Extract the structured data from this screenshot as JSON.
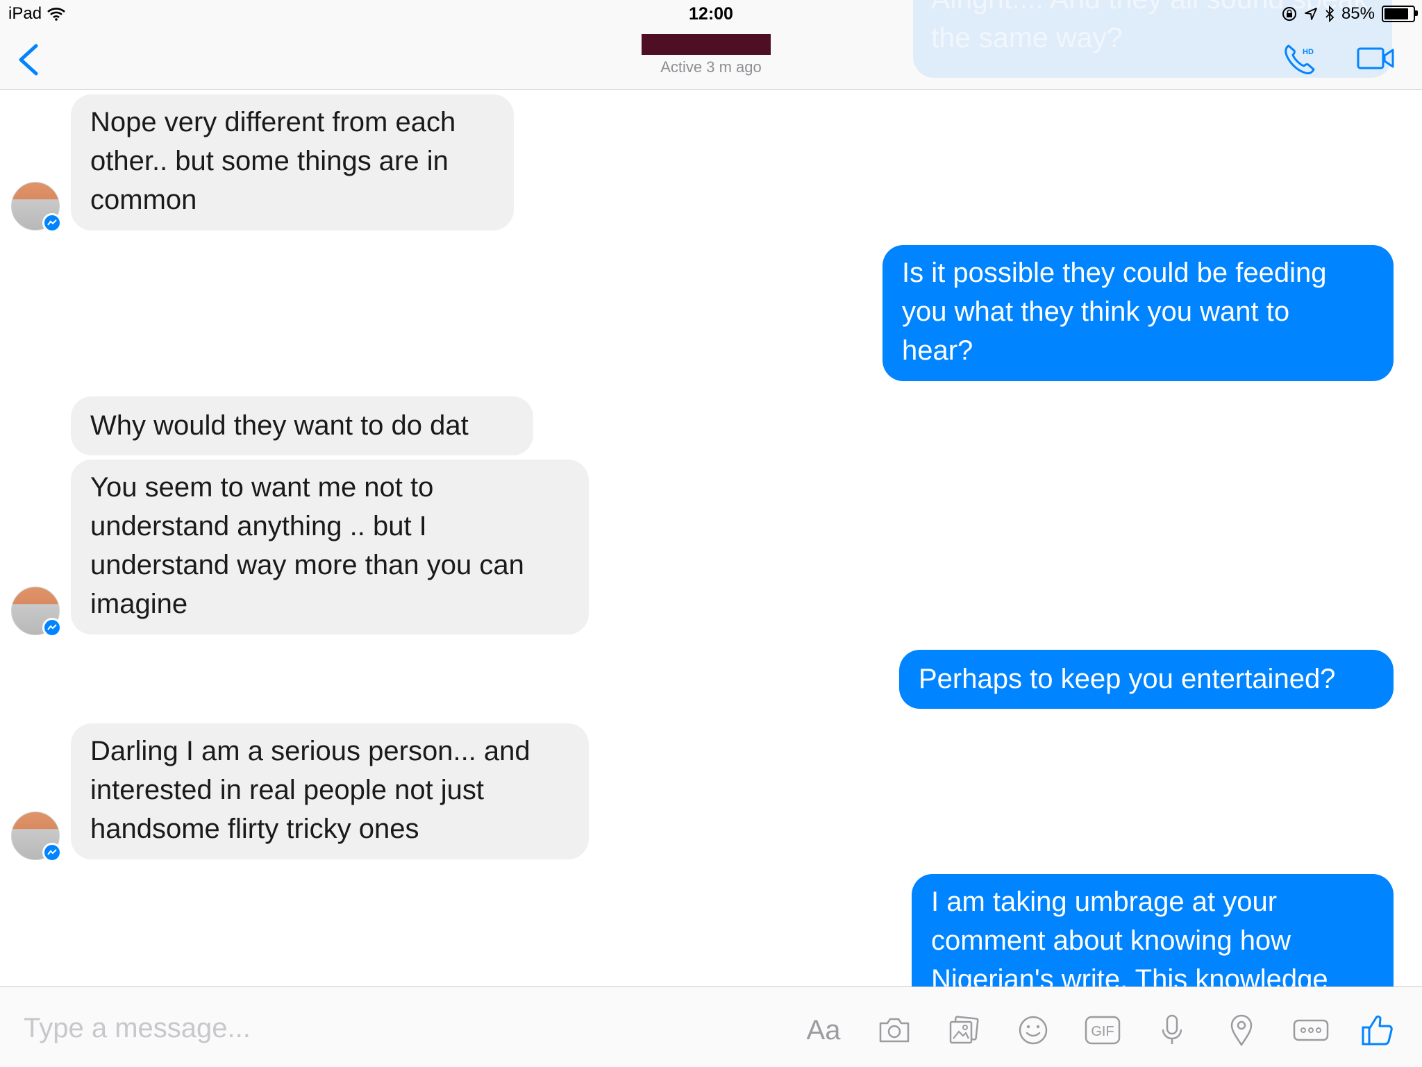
{
  "status_bar": {
    "device": "iPad",
    "time": "12:00",
    "battery_text": "85%",
    "battery_level": 0.85
  },
  "header": {
    "active_status": "Active 3 m ago",
    "ghost_message": "Alright.... And they all sound\nspeak the same way?"
  },
  "messages": [
    {
      "side": "in",
      "text": "Nope very different from each\nother.. but some things are in\ncommon"
    },
    {
      "side": "out",
      "text": "Is it possible they could be feeding\nyou what they think you want to\nhear?"
    },
    {
      "side": "in",
      "text": "Why would they want to do dat"
    },
    {
      "side": "in",
      "text": "You seem to want me not to\nunderstand anything .. but I\nunderstand way more than you can\nimagine"
    },
    {
      "side": "out",
      "text": "Perhaps to keep you entertained?"
    },
    {
      "side": "in",
      "text": "Darling I am a serious person... and\ninterested in real people not just\nhandsome flirty tricky ones"
    },
    {
      "side": "out",
      "text": "I am taking umbrage at your\ncomment about knowing how\nNigerian's write. This knowledge"
    }
  ],
  "composer": {
    "placeholder": "Type a message...",
    "text_tool_label": "Aa",
    "gif_label": "GIF"
  },
  "colors": {
    "accent": "#0084ff",
    "incoming_bubble": "#f0f0f0",
    "redaction": "#4e0f25"
  },
  "icons": [
    "wifi-icon",
    "orientation-lock-icon",
    "location-arrow-icon",
    "bluetooth-icon",
    "battery-icon",
    "back-chevron-icon",
    "hd-call-icon",
    "video-call-icon",
    "messenger-badge-icon",
    "camera-icon",
    "gallery-icon",
    "emoji-icon",
    "gif-icon",
    "microphone-icon",
    "location-pin-icon",
    "more-icon",
    "like-icon"
  ]
}
